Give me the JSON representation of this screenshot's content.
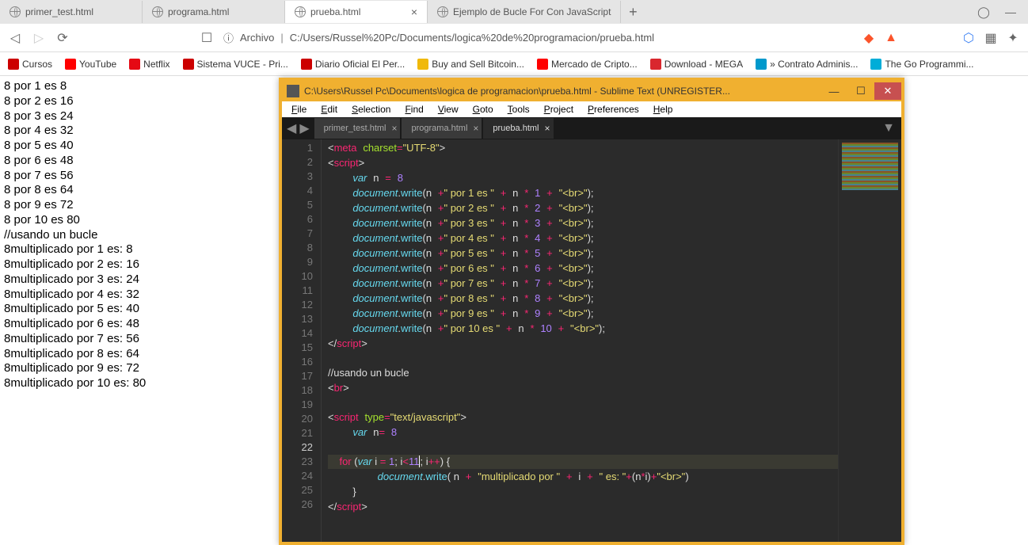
{
  "browser": {
    "tabs": [
      {
        "title": "primer_test.html",
        "icon": "globe",
        "active": false
      },
      {
        "title": "programa.html",
        "icon": "globe",
        "active": false
      },
      {
        "title": "prueba.html",
        "icon": "globe",
        "active": true
      },
      {
        "title": "Ejemplo de Bucle For Con JavaScript",
        "icon": "doc",
        "active": false
      }
    ],
    "url_prefix": "Archivo",
    "url": "C:/Users/Russel%20Pc/Documents/logica%20de%20programacion/prueba.html"
  },
  "bookmarks": [
    {
      "label": "Cursos",
      "color": "#c00"
    },
    {
      "label": "YouTube",
      "color": "#f00"
    },
    {
      "label": "Netflix",
      "color": "#e50914"
    },
    {
      "label": "Sistema VUCE - Pri...",
      "color": "#c00"
    },
    {
      "label": "Diario Oficial El Per...",
      "color": "#c00"
    },
    {
      "label": "Buy and Sell Bitcoin...",
      "color": "#f0b90b"
    },
    {
      "label": "Mercado de Cripto...",
      "color": "#f00"
    },
    {
      "label": "Download - MEGA",
      "color": "#d9272e"
    },
    {
      "label": "» Contrato Adminis...",
      "color": "#09c"
    },
    {
      "label": "The Go Programmi...",
      "color": "#00add8"
    }
  ],
  "page_output": {
    "por_lines": [
      "8 por 1 es 8",
      "8 por 2 es 16",
      "8 por 3 es 24",
      "8 por 4 es 32",
      "8 por 5 es 40",
      "8 por 6 es 48",
      "8 por 7 es 56",
      "8 por 8 es 64",
      "8 por 9 es 72",
      "8 por 10 es 80"
    ],
    "comment": "//usando un bucle",
    "mult_lines": [
      "8multiplicado por 1 es: 8",
      "8multiplicado por 2 es: 16",
      "8multiplicado por 3 es: 24",
      "8multiplicado por 4 es: 32",
      "8multiplicado por 5 es: 40",
      "8multiplicado por 6 es: 48",
      "8multiplicado por 7 es: 56",
      "8multiplicado por 8 es: 64",
      "8multiplicado por 9 es: 72",
      "8multiplicado por 10 es: 80"
    ]
  },
  "sublime": {
    "title": "C:\\Users\\Russel Pc\\Documents\\logica de programacion\\prueba.html - Sublime Text (UNREGISTER...",
    "menu": [
      "File",
      "Edit",
      "Selection",
      "Find",
      "View",
      "Goto",
      "Tools",
      "Project",
      "Preferences",
      "Help"
    ],
    "tabs": [
      {
        "name": "primer_test.html",
        "active": false
      },
      {
        "name": "programa.html",
        "active": false
      },
      {
        "name": "prueba.html",
        "active": true
      }
    ],
    "line_count": 26,
    "highlighted_line": 22,
    "code": {
      "n_value": "8",
      "loop_limit": "11",
      "comment_text": "//usando un bucle",
      "script_type": "\"text/javascript\"",
      "charset": "\"UTF-8\"",
      "write_lines": [
        {
          "idx": "1"
        },
        {
          "idx": "2"
        },
        {
          "idx": "3"
        },
        {
          "idx": "4"
        },
        {
          "idx": "5"
        },
        {
          "idx": "6"
        },
        {
          "idx": "7"
        },
        {
          "idx": "8"
        },
        {
          "idx": "9"
        }
      ]
    }
  }
}
